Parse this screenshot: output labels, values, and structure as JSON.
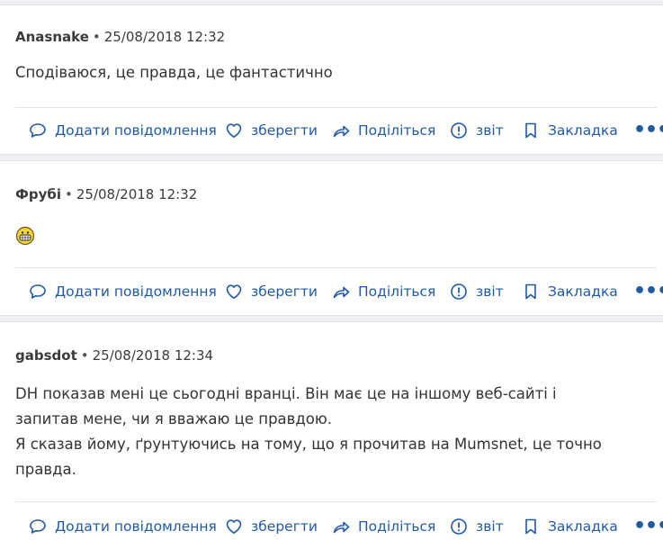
{
  "actions": {
    "reply": "Додати повідомлення",
    "save": "зберегти",
    "share": "Поділіться",
    "report": "звіт",
    "bookmark": "Закладка",
    "more": "•••"
  },
  "posts": [
    {
      "author": "Anasnake",
      "separator": "•",
      "date": "25/08/2018 12:32",
      "lines": [
        "Сподіваюся, це правда, це фантастично"
      ]
    },
    {
      "author": "Фрубі",
      "separator": "•",
      "date": "25/08/2018 12:32",
      "lines": [],
      "emoji": "grinning-face-icon"
    },
    {
      "author": "gabsdot",
      "separator": "•",
      "date": "25/08/2018 12:34",
      "lines": [
        "DH показав мені це сьогодні вранці. Він має це на іншому веб-сайті і",
        "запитав мене, чи я вважаю це правдою.",
        "Я сказав йому, ґрунтуючись на тому, що я прочитав на Mumsnet, це точно",
        "правда."
      ]
    }
  ],
  "colors": {
    "action": "#1f5aa6",
    "separator_band": "#eff0f4",
    "divider": "#e3e4e8"
  }
}
